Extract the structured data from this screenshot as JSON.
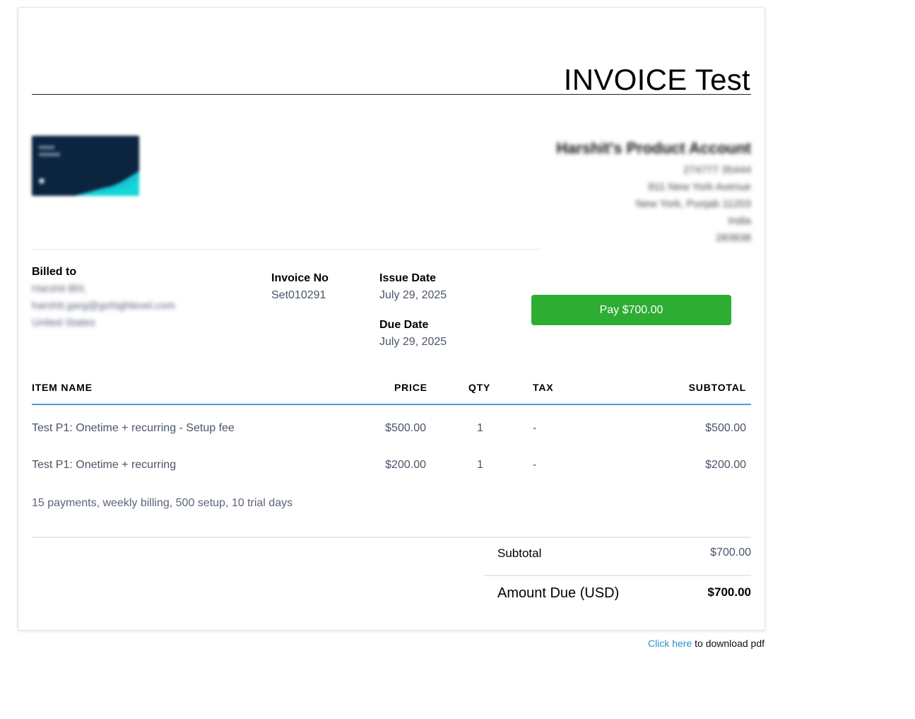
{
  "invoice": {
    "title": "INVOICE Test"
  },
  "company": {
    "name": "Harshit's Product Account",
    "lines": [
      "274777 35444",
      "811 New York Avenue",
      "New York, Punjab 11203",
      "India",
      "283838"
    ]
  },
  "billed_to": {
    "label": "Billed to",
    "name": "Harshit Bhl,",
    "email": "harshit.garg@gohighlevel.com",
    "country": "United States"
  },
  "meta": {
    "invoice_no_label": "Invoice No",
    "invoice_no": "Set010291",
    "issue_date_label": "Issue Date",
    "issue_date": "July 29, 2025",
    "due_date_label": "Due Date",
    "due_date": "July 29, 2025"
  },
  "pay_button": {
    "label": "Pay $700.00",
    "color": "#2ead33"
  },
  "table": {
    "headers": {
      "item": "ITEM NAME",
      "price": "PRICE",
      "qty": "QTY",
      "tax": "TAX",
      "subtotal": "SUBTOTAL"
    },
    "rows": [
      {
        "item": "Test P1: Onetime + recurring - Setup fee",
        "price": "$500.00",
        "qty": "1",
        "tax": "-",
        "subtotal": "$500.00"
      },
      {
        "item": "Test P1: Onetime + recurring",
        "price": "$200.00",
        "qty": "1",
        "tax": "-",
        "subtotal": "$200.00"
      }
    ],
    "note": "15 payments, weekly billing, 500 setup, 10 trial days"
  },
  "totals": {
    "subtotal_label": "Subtotal",
    "subtotal": "$700.00",
    "amount_due_label": "Amount Due (USD)",
    "amount_due": "$700.00"
  },
  "download": {
    "link_text": "Click here",
    "suffix": " to download pdf"
  },
  "colors": {
    "accent_line": "#4a9fdc",
    "link": "#2a93c8"
  }
}
